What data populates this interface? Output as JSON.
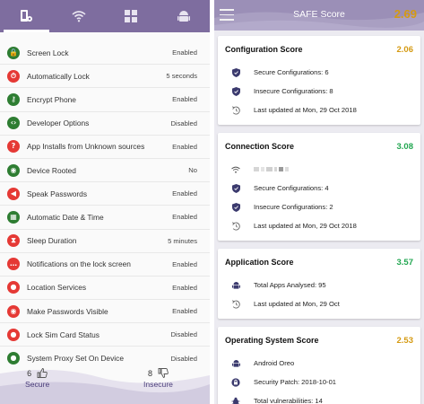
{
  "left_panel": {
    "tabs": [
      {
        "icon": "phone-settings-icon",
        "active": true
      },
      {
        "icon": "wifi-icon",
        "active": false
      },
      {
        "icon": "apps-grid-icon",
        "active": false
      },
      {
        "icon": "android-icon",
        "active": false
      }
    ],
    "settings": [
      {
        "label": "Screen Lock",
        "value": "Enabled",
        "status": "green",
        "icon": "lock-icon",
        "glyph": "🔒"
      },
      {
        "label": "Automatically Lock",
        "value": "5 seconds",
        "status": "red",
        "icon": "timer-lock-icon",
        "glyph": "⏱"
      },
      {
        "label": "Encrypt Phone",
        "value": "Enabled",
        "status": "green",
        "icon": "key-icon",
        "glyph": "⚷"
      },
      {
        "label": "Developer Options",
        "value": "Disabled",
        "status": "green",
        "icon": "code-icon",
        "glyph": "‹›"
      },
      {
        "label": "App Installs from Unknown sources",
        "value": "Enabled",
        "status": "red",
        "icon": "question-icon",
        "glyph": "?"
      },
      {
        "label": "Device Rooted",
        "value": "No",
        "status": "green",
        "icon": "android-icon",
        "glyph": "◉"
      },
      {
        "label": "Speak Passwords",
        "value": "Enabled",
        "status": "red",
        "icon": "megaphone-icon",
        "glyph": "◀"
      },
      {
        "label": "Automatic Date & Time",
        "value": "Enabled",
        "status": "green",
        "icon": "calendar-icon",
        "glyph": "▦"
      },
      {
        "label": "Sleep Duration",
        "value": "5 minutes",
        "status": "red",
        "icon": "hourglass-icon",
        "glyph": "⧗"
      },
      {
        "label": "Notifications on the lock screen",
        "value": "Enabled",
        "status": "red",
        "icon": "chat-icon",
        "glyph": "…"
      },
      {
        "label": "Location Services",
        "value": "Enabled",
        "status": "red",
        "icon": "location-pin-icon",
        "glyph": "●"
      },
      {
        "label": "Make Passwords Visible",
        "value": "Enabled",
        "status": "red",
        "icon": "eye-icon",
        "glyph": "◉"
      },
      {
        "label": "Lock Sim Card Status",
        "value": "Disabled",
        "status": "red",
        "icon": "location-pin-icon",
        "glyph": "●"
      },
      {
        "label": "System Proxy Set On Device",
        "value": "Disabled",
        "status": "green",
        "icon": "location-pin-icon",
        "glyph": "●"
      }
    ],
    "footer": {
      "secure_count": "6",
      "secure_label": "Secure",
      "insecure_count": "8",
      "insecure_label": "Insecure"
    }
  },
  "right_panel": {
    "title": "SAFE Score",
    "overall_score": "2.69",
    "cards": [
      {
        "title": "Configuration Score",
        "score": "2.06",
        "score_color": "#d59a12",
        "rows": [
          {
            "icon": "shield-icon",
            "text": "Secure Configurations: 6"
          },
          {
            "icon": "shield-icon",
            "text": "Insecure Configurations: 8"
          },
          {
            "icon": "update-icon",
            "text": "Last updated at Mon, 29 Oct 2018"
          }
        ]
      },
      {
        "title": "Connection Score",
        "score": "3.08",
        "score_color": "#21a650",
        "rows": [
          {
            "icon": "wifi-icon",
            "text": ""
          },
          {
            "icon": "shield-icon",
            "text": "Secure Configurations: 4"
          },
          {
            "icon": "shield-icon",
            "text": "Insecure Configurations: 2"
          },
          {
            "icon": "update-icon",
            "text": "Last updated at Mon, 29 Oct 2018"
          }
        ]
      },
      {
        "title": "Application Score",
        "score": "3.57",
        "score_color": "#21a650",
        "rows": [
          {
            "icon": "android-icon",
            "text": "Total Apps Analysed: 95"
          },
          {
            "icon": "update-icon",
            "text": "Last updated at Mon, 29 Oct"
          }
        ]
      },
      {
        "title": "Operating System Score",
        "score": "2.53",
        "score_color": "#d59a12",
        "rows": [
          {
            "icon": "android-icon",
            "text": "Android Oreo"
          },
          {
            "icon": "security-patch-icon",
            "text": "Security Patch: 2018-10-01"
          },
          {
            "icon": "bug-icon",
            "text": "Total vulnerabilities: 14"
          }
        ]
      }
    ]
  },
  "colors": {
    "tabbar": "#7e6d9f",
    "header": "#9b8fb7",
    "status_red": "#e53935",
    "status_green": "#2e7d32",
    "score_yellow": "#d59a12",
    "score_green": "#21a650",
    "label_purple": "#4a3d7a"
  }
}
